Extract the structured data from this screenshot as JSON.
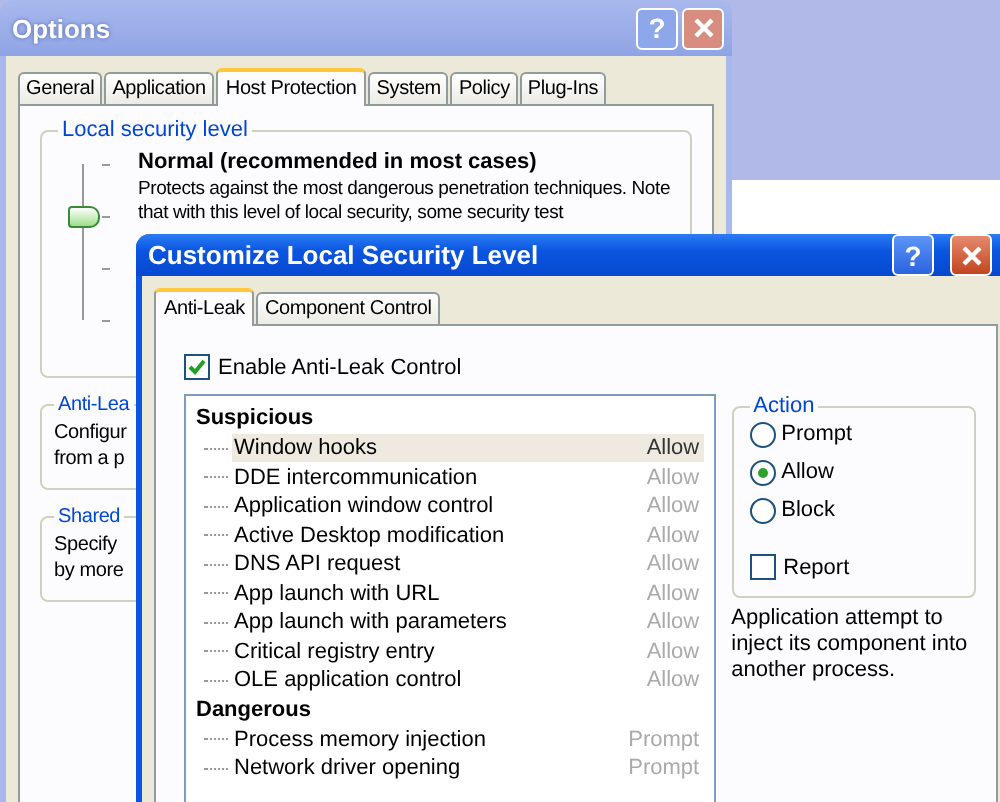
{
  "options_window": {
    "title": "Options",
    "help_button": "?",
    "tabs": [
      {
        "label": "General",
        "selected": false
      },
      {
        "label": "Application",
        "selected": false
      },
      {
        "label": "Host Protection",
        "selected": true
      },
      {
        "label": "System",
        "selected": false
      },
      {
        "label": "Policy",
        "selected": false
      },
      {
        "label": "Plug-Ins",
        "selected": false
      }
    ],
    "security_level": {
      "legend": "Local security level",
      "level": 0.67,
      "heading": "Normal (recommended in most cases)",
      "description": "Protects against the most dangerous penetration techniques. Note that with this level of local security, some security test"
    },
    "groups": [
      {
        "legend": "Anti-Lea",
        "lines": [
          "Configur",
          "from a p"
        ]
      },
      {
        "legend": "Shared",
        "lines": [
          "Specify",
          "by more"
        ]
      }
    ]
  },
  "customize_window": {
    "title": "Customize Local Security Level",
    "help_button": "?",
    "tabs": [
      {
        "label": "Anti-Leak",
        "selected": true
      },
      {
        "label": "Component Control",
        "selected": false
      }
    ],
    "enable_checkbox": {
      "label": "Enable Anti-Leak Control",
      "checked": true
    },
    "tree": [
      {
        "label": "Suspicious",
        "children": [
          {
            "label": "Window hooks",
            "value": "Allow",
            "selected": true
          },
          {
            "label": "DDE intercommunication",
            "value": "Allow",
            "selected": false
          },
          {
            "label": "Application window control",
            "value": "Allow",
            "selected": false
          },
          {
            "label": "Active Desktop modification",
            "value": "Allow",
            "selected": false
          },
          {
            "label": "DNS API request",
            "value": "Allow",
            "selected": false
          },
          {
            "label": "App launch with URL",
            "value": "Allow",
            "selected": false
          },
          {
            "label": "App launch with parameters",
            "value": "Allow",
            "selected": false
          },
          {
            "label": "Critical registry entry",
            "value": "Allow",
            "selected": false
          },
          {
            "label": "OLE application control",
            "value": "Allow",
            "selected": false
          }
        ]
      },
      {
        "label": "Dangerous",
        "children": [
          {
            "label": "Process memory injection",
            "value": "Prompt",
            "selected": false
          },
          {
            "label": "Network driver opening",
            "value": "Prompt",
            "selected": false
          }
        ]
      }
    ],
    "action": {
      "legend": "Action",
      "options": [
        {
          "label": "Prompt",
          "selected": false
        },
        {
          "label": "Allow",
          "selected": true
        },
        {
          "label": "Block",
          "selected": false
        }
      ],
      "report": {
        "label": "Report",
        "checked": false
      }
    },
    "description": "Application attempt to inject its component into another process."
  }
}
